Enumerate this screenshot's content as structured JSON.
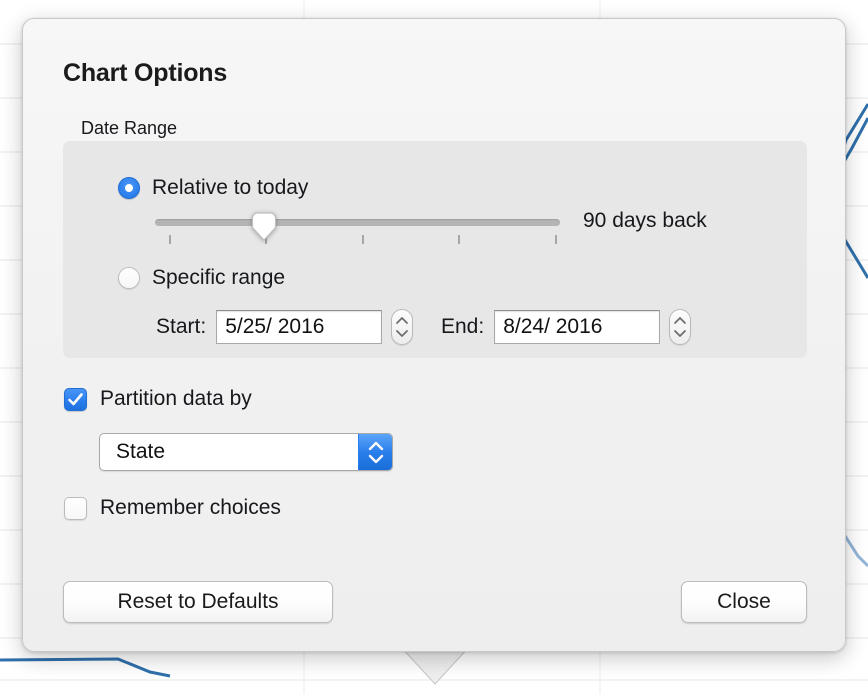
{
  "background": {
    "type": "line-chart",
    "gridline_color": "#e6e6e6",
    "line_color": "#2f6fab",
    "secondary_line_color": "#93b5d8"
  },
  "dialog": {
    "title": "Chart Options",
    "date_range": {
      "group_label": "Date Range",
      "relative_option": {
        "label": "Relative to today",
        "selected": true,
        "slider": {
          "value_label": "90 days back",
          "position_percent": 27,
          "tick_count": 5
        }
      },
      "specific_option": {
        "label": "Specific range",
        "selected": false,
        "start_label": "Start:",
        "start_value": "5/25/ 2016",
        "end_label": "End:",
        "end_value": "8/24/ 2016",
        "stepper_icon": "stepper-up-down-icon"
      }
    },
    "partition": {
      "checkbox_label": "Partition data by",
      "checked": true,
      "select_value": "State",
      "select_arrow_icon": "chevron-up-down-icon"
    },
    "remember": {
      "checkbox_label": "Remember choices",
      "checked": false
    },
    "footer": {
      "reset_label": "Reset to Defaults",
      "close_label": "Close"
    },
    "accent_color": "#2b7fec"
  }
}
